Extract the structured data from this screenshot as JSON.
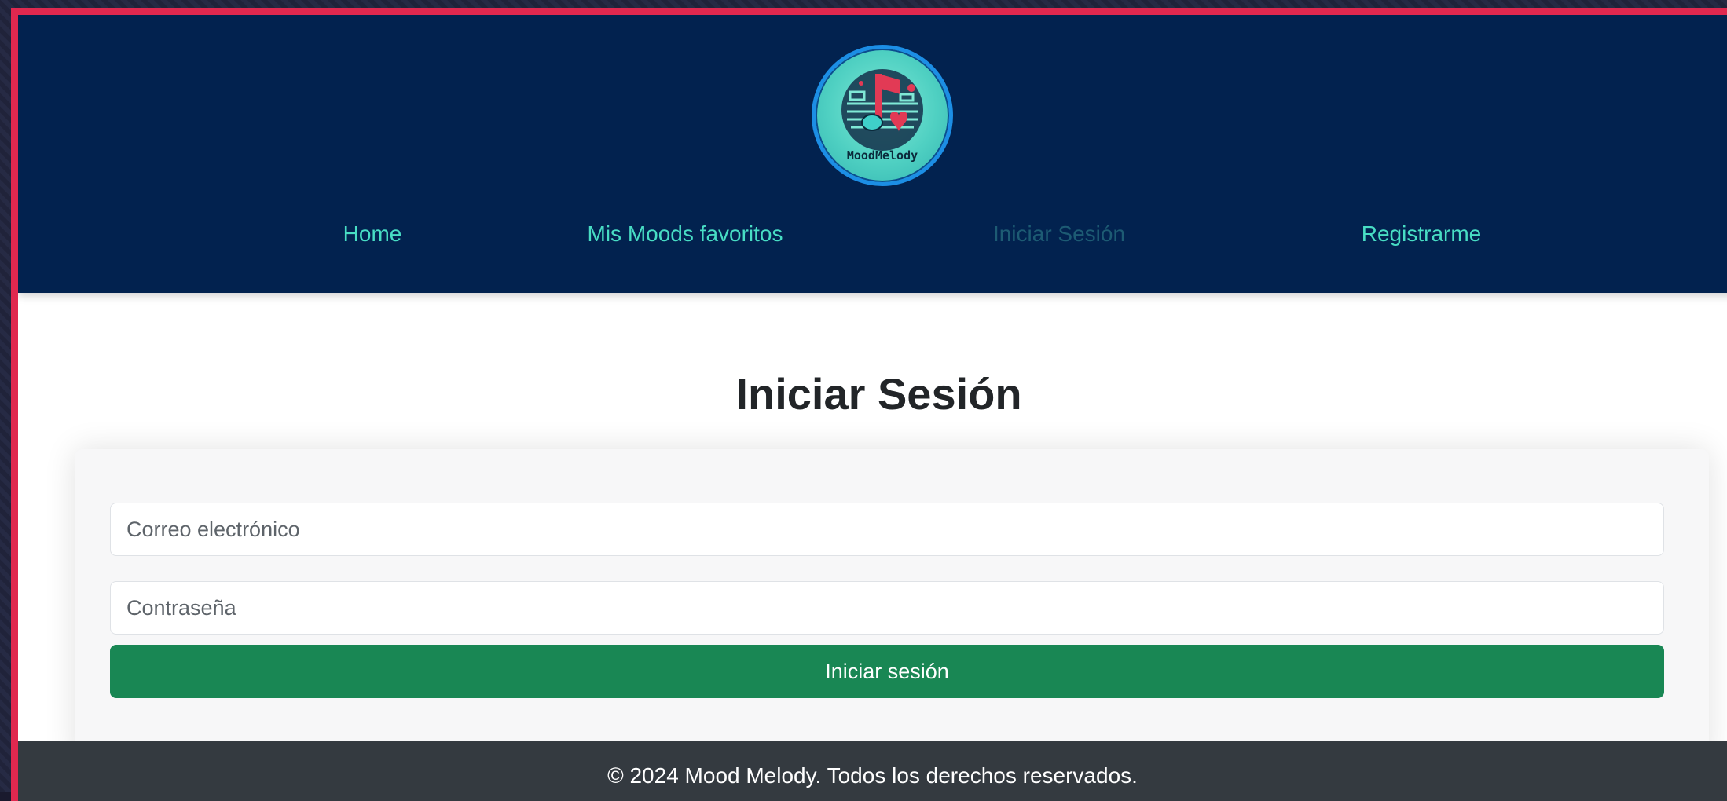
{
  "brand": {
    "logo_text": "MoodMelody",
    "accent": "#48ddc4",
    "navbar_bg": "#02224f"
  },
  "nav": {
    "items": [
      {
        "label": "Home",
        "state": "normal"
      },
      {
        "label": "Mis Moods favoritos",
        "state": "normal"
      },
      {
        "label": "Iniciar Sesión",
        "state": "disabled"
      },
      {
        "label": "Registrarme",
        "state": "normal"
      }
    ]
  },
  "main": {
    "title": "Iniciar Sesión"
  },
  "form": {
    "email_placeholder": "Correo electrónico",
    "password_placeholder": "Contraseña",
    "submit_label": "Iniciar sesión",
    "submit_color": "#198754"
  },
  "footer": {
    "text": "© 2024 Mood Melody. Todos los derechos reservados."
  },
  "frame_border_color": "#e0284f"
}
